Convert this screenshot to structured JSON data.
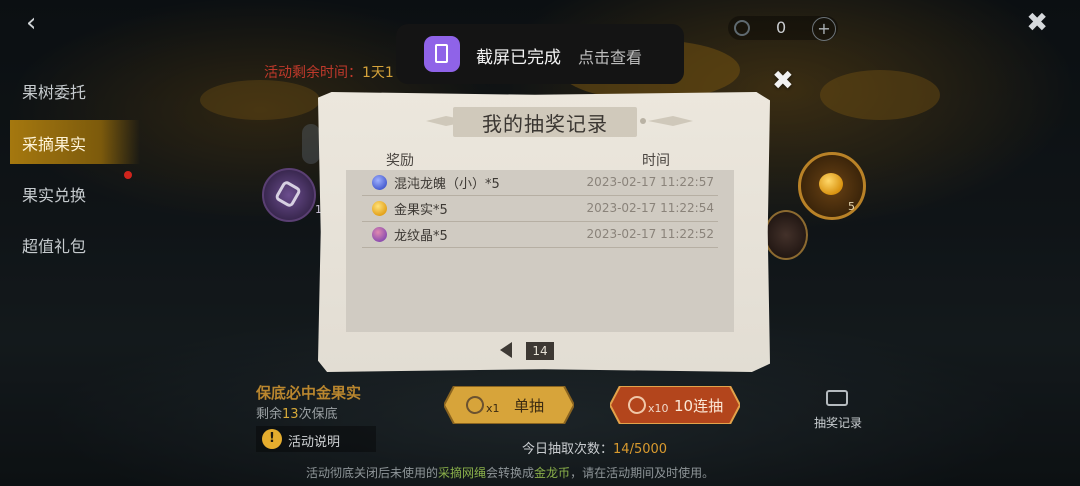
{
  "topbar": {
    "back_icon": "back-arrow-icon",
    "close_icon": "close-x-icon",
    "currency_value": "0",
    "plus": "+"
  },
  "toast": {
    "title": "截屏已完成",
    "action": "点击查看"
  },
  "timer": {
    "label": "活动剩余时间：",
    "value": "1天1"
  },
  "sidebar": {
    "items": [
      {
        "label": "果树委托",
        "active": false
      },
      {
        "label": "采摘果实",
        "active": true
      },
      {
        "label": "果实兑换",
        "active": false
      },
      {
        "label": "超值礼包",
        "active": false
      }
    ]
  },
  "medals": {
    "right_count": "5",
    "left_count": "1"
  },
  "dialog": {
    "title": "我的抽奖记录",
    "col_reward": "奖励",
    "col_time": "时间",
    "rows": [
      {
        "name": "混沌龙魄（小）*5",
        "time": "2023-02-17 11:22:57",
        "icon": "chaos-soul-icon",
        "color": "#4a5fd0"
      },
      {
        "name": "金果实*5",
        "time": "2023-02-17 11:22:54",
        "icon": "golden-fruit-icon",
        "color": "#e3a21c"
      },
      {
        "name": "龙纹晶*5",
        "time": "2023-02-17 11:22:52",
        "icon": "dragon-crystal-icon",
        "color": "#8e4fb0"
      }
    ],
    "page": "14"
  },
  "bottom": {
    "guarantee_title": "保底必中金果实",
    "guarantee_prefix": "剩余",
    "guarantee_count": "13",
    "guarantee_suffix": "次保底",
    "info_label": "活动说明",
    "single_mult": "x1",
    "single_label": "单抽",
    "ten_mult": "x10",
    "ten_label": "10连抽",
    "records_label": "抽奖记录",
    "today_label": "今日抽取次数：",
    "today_count": "14",
    "today_max": "/5000",
    "footer_a": "活动彻底关闭后未使用的",
    "footer_b": "采摘网绳",
    "footer_c": "会转换成",
    "footer_d": "金龙币",
    "footer_e": "，请在活动期间及时使用。"
  },
  "colors": {
    "active_tab": "#a5780f",
    "dialog_bg": "#ece7dd",
    "accent_gold": "#d99a2e",
    "timer_red": "#c0392b"
  }
}
